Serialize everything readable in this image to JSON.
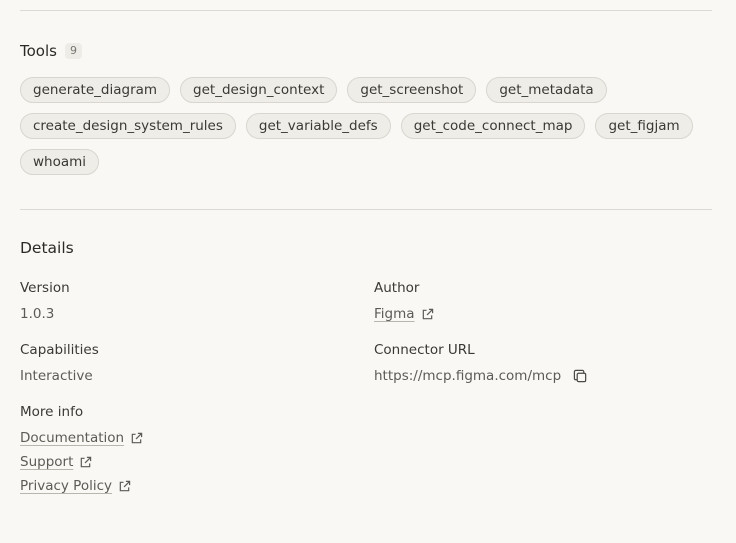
{
  "tools": {
    "title": "Tools",
    "count": "9",
    "items": [
      "generate_diagram",
      "get_design_context",
      "get_screenshot",
      "get_metadata",
      "create_design_system_rules",
      "get_variable_defs",
      "get_code_connect_map",
      "get_figjam",
      "whoami"
    ]
  },
  "details": {
    "title": "Details",
    "version_label": "Version",
    "version_value": "1.0.3",
    "author_label": "Author",
    "author_value": "Figma",
    "capabilities_label": "Capabilities",
    "capabilities_value": "Interactive",
    "connector_url_label": "Connector URL",
    "connector_url_value": "https://mcp.figma.com/mcp",
    "more_info_label": "More info",
    "links": {
      "documentation": "Documentation",
      "support": "Support",
      "privacy_policy": "Privacy Policy"
    }
  }
}
